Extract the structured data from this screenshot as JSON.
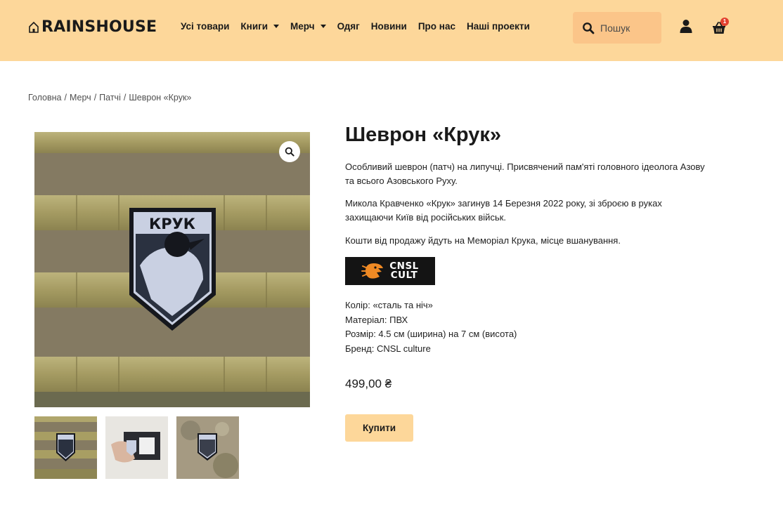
{
  "header": {
    "logo_text": "RAINSHOUSE",
    "nav": [
      {
        "label": "Усі товари",
        "has_dropdown": false
      },
      {
        "label": "Книги",
        "has_dropdown": true
      },
      {
        "label": "Мерч",
        "has_dropdown": true
      },
      {
        "label": "Одяг",
        "has_dropdown": false
      },
      {
        "label": "Новини",
        "has_dropdown": false
      },
      {
        "label": "Про нас",
        "has_dropdown": false
      },
      {
        "label": "Наші проекти",
        "has_dropdown": false
      }
    ],
    "search_placeholder": "Пошук",
    "cart_count": "1",
    "colors": {
      "header_bg": "#fdd79a",
      "search_bg": "#fbc589",
      "badge": "#e2402f"
    }
  },
  "breadcrumb": [
    "Головна",
    "Мерч",
    "Патчі",
    "Шеврон «Крук»"
  ],
  "product": {
    "title": "Шеврон «Крук»",
    "description": [
      "Особливий шеврон (патч) на липучці. Присвячений пам'яті головного ідеолога Азову та всього Азовського Руху.",
      "Микола Кравченко «Крук» загинув 14 Березня 2022 року, зі зброєю в руках захищаючи Київ від російських військ.",
      "Кошти від продажу йдуть на Меморіал Крука, місце вшанування."
    ],
    "brand_logo_text": [
      "CNSL",
      "CULT"
    ],
    "patch_text": "КРУК",
    "specs": [
      "Колір: «сталь та ніч»",
      "Матеріал: ПВХ",
      "Розмір: 4.5 см (ширина) на 7 см (висота)",
      "Бренд: CNSL culture"
    ],
    "price": "499,00 ₴",
    "buy_label": "Купити"
  },
  "icons": [
    "home-icon",
    "search-icon",
    "user-icon",
    "cart-icon",
    "zoom-icon"
  ]
}
